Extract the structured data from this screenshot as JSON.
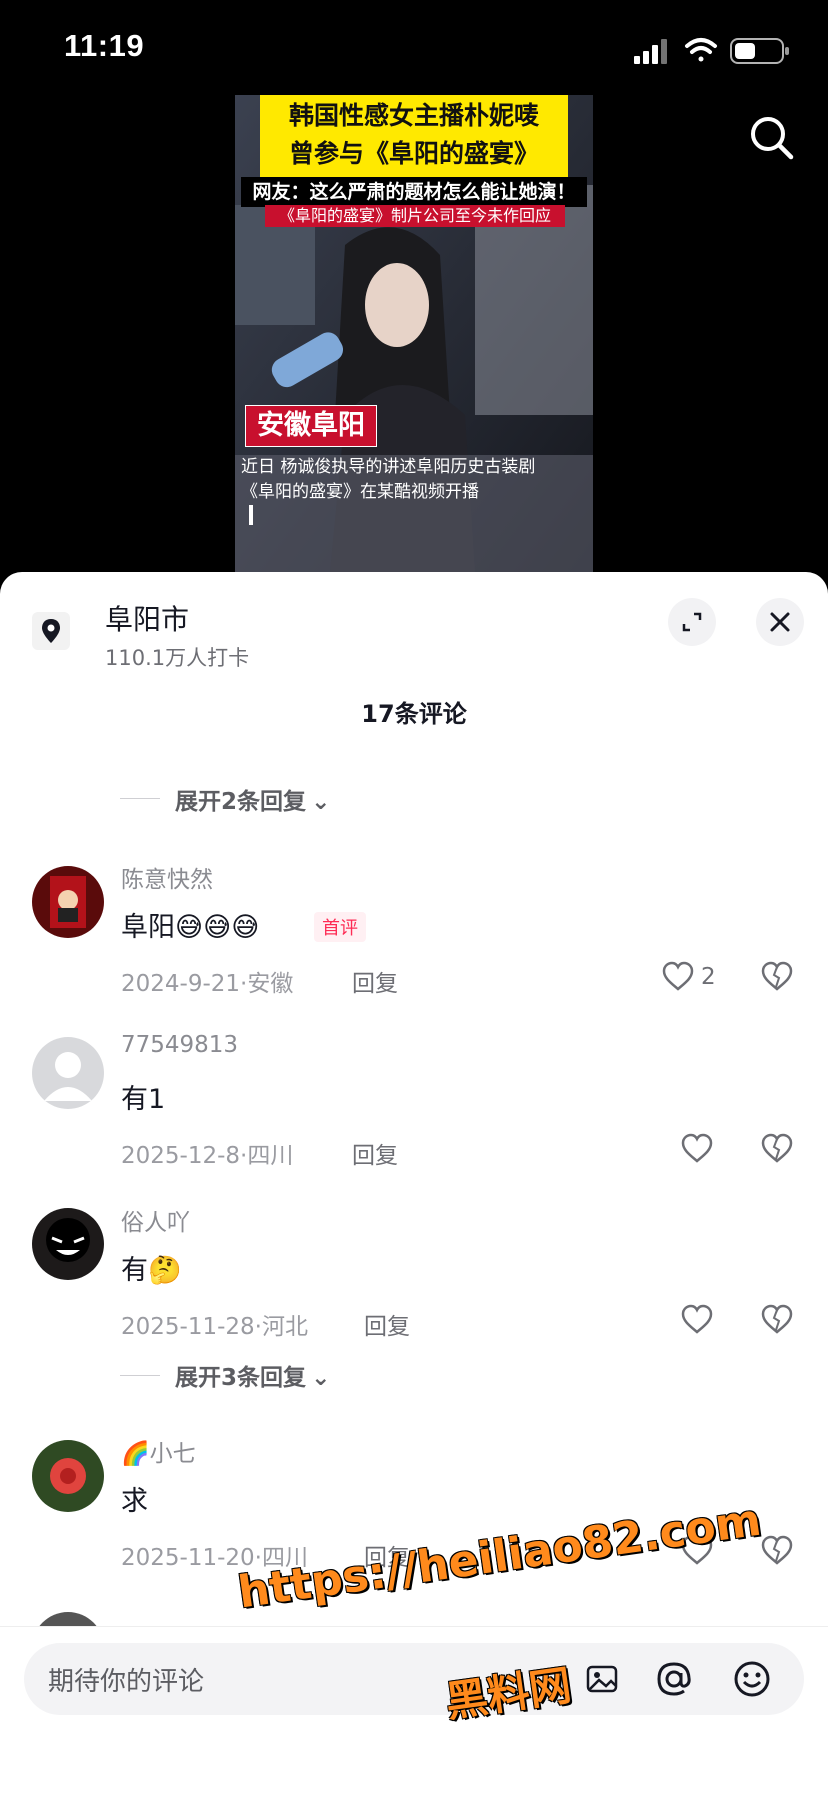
{
  "status": {
    "time": "11:19"
  },
  "video": {
    "headline_line1": "韩国性感女主播朴妮唛",
    "headline_line2": "曾参与《阜阳的盛宴》",
    "sub1": "网友：这么严肃的题材怎么能让她演！",
    "sub2": "《阜阳的盛宴》制片公司至今未作回应",
    "tag": "安徽阜阳",
    "caption1": "近日 杨诚俊执导的讲述阜阳历史古装剧",
    "caption2": "《阜阳的盛宴》在某酷视频开播"
  },
  "location": {
    "title": "阜阳市",
    "subtitle": "110.1万人打卡"
  },
  "comments_header": "17条评论",
  "expand_top": "展开2条回复",
  "comments": [
    {
      "user": "陈意快然",
      "text": "阜阳😅😅😅",
      "badge": "首评",
      "date": "2024-9-21",
      "region": "安徽",
      "reply": "回复",
      "likes": "2"
    },
    {
      "user": "77549813",
      "text": "有1",
      "date": "2025-12-8",
      "region": "四川",
      "reply": "回复"
    },
    {
      "user": "俗人吖",
      "text": "有🤔",
      "date": "2025-11-28",
      "region": "河北",
      "reply": "回复"
    },
    {
      "user": "🌈小七",
      "text": "求",
      "date": "2025-11-20",
      "region": "四川",
      "reply": "回复"
    }
  ],
  "expand_mid": "展开3条回复",
  "input": {
    "placeholder": "期待你的评论"
  },
  "watermark": {
    "line1": "https://heiliao82.com",
    "line2": "黑料网"
  },
  "colors": {
    "accent": "#fe2c55",
    "highlight": "#ffe900",
    "watermark": "#ff8a1c"
  }
}
